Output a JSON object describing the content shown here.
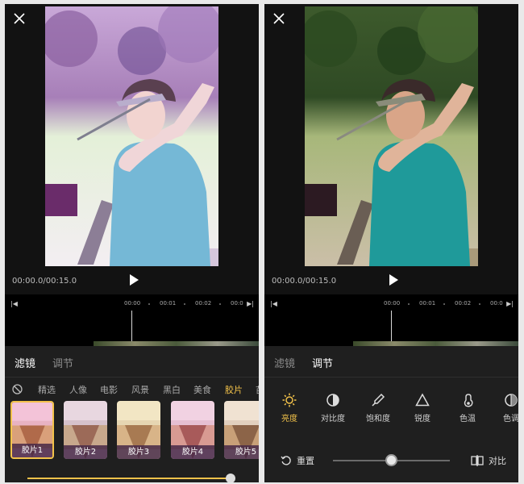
{
  "left": {
    "time": "00:00.0/00:15.0",
    "timeline": {
      "ticks": [
        "00:00",
        "00:01",
        "00:02",
        "00:0"
      ]
    },
    "tabs": [
      "滤镜",
      "调节"
    ],
    "categories": [
      "精选",
      "人像",
      "电影",
      "风景",
      "黑白",
      "美食",
      "胶片",
      "苗"
    ],
    "active_category": "胶片",
    "filters": [
      "胶片1",
      "胶片2",
      "胶片3",
      "胶片4",
      "胶片5"
    ],
    "selected_filter": "胶片1",
    "intensity_fraction": 0.9,
    "accent_color": "#f2c24a"
  },
  "right": {
    "time": "00:00.0/00:15.0",
    "timeline": {
      "ticks": [
        "00:00",
        "00:01",
        "00:02",
        "00:0"
      ]
    },
    "tabs": [
      "滤镜",
      "调节"
    ],
    "tools": [
      {
        "label": "亮度",
        "icon": "sun-icon"
      },
      {
        "label": "对比度",
        "icon": "contrast-icon"
      },
      {
        "label": "饱和度",
        "icon": "dropper-icon"
      },
      {
        "label": "锐度",
        "icon": "triangle-icon"
      },
      {
        "label": "色温",
        "icon": "thermometer-icon"
      },
      {
        "label": "色调",
        "icon": "tone-icon"
      }
    ],
    "active_tool": "亮度",
    "reset_label": "重置",
    "compare_label": "对比",
    "adjust_fraction": 0.5
  }
}
